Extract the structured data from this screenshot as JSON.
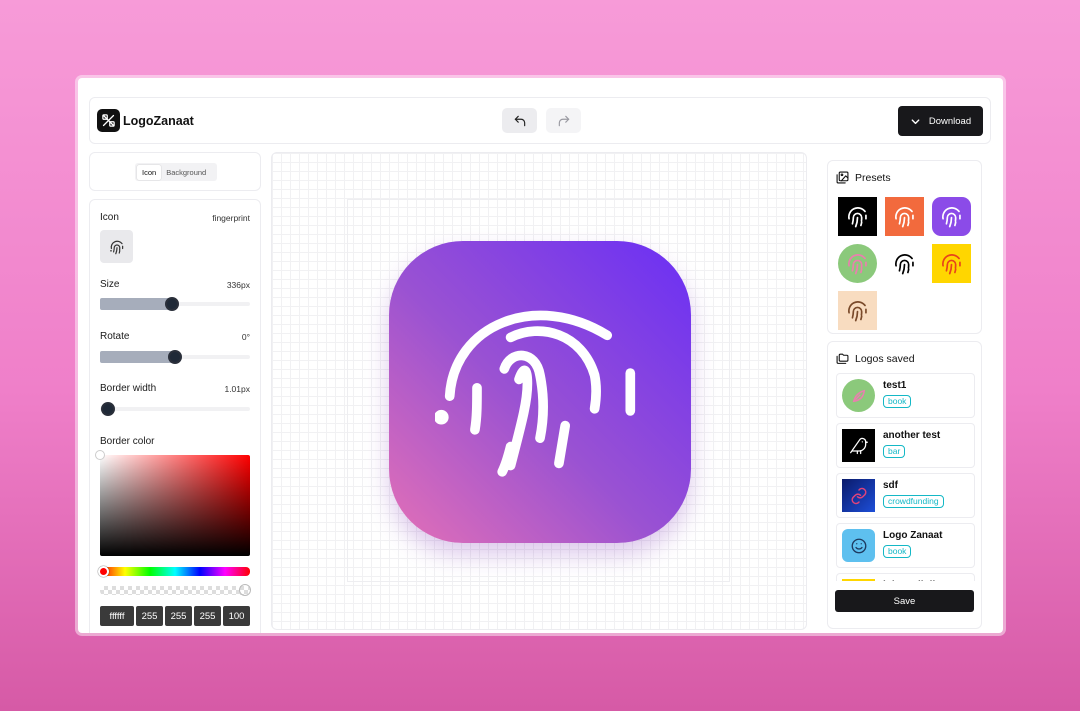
{
  "app": {
    "name": "LogoZanaat"
  },
  "header": {
    "download_label": "Download"
  },
  "tabs": [
    {
      "label": "Icon",
      "active": true
    },
    {
      "label": "Background",
      "active": false
    }
  ],
  "controls": {
    "icon": {
      "label": "Icon",
      "value": "fingerprint"
    },
    "size": {
      "label": "Size",
      "value": "336px",
      "level": 0.48
    },
    "rotate": {
      "label": "Rotate",
      "value": "0°",
      "level": 0.5
    },
    "border_width": {
      "label": "Border width",
      "value": "1.01px",
      "level": 0.05
    },
    "border_color": {
      "label": "Border color",
      "hex": "ffffff",
      "r": "255",
      "g": "255",
      "b": "255",
      "a": "100"
    }
  },
  "canvas": {
    "icon": "fingerprint-icon",
    "gradient": [
      "#6a2ff5",
      "#9a52d2",
      "#e470b6"
    ]
  },
  "presets": {
    "title": "Presets",
    "items": [
      {
        "bg": "#000000",
        "fg": "#ffffff",
        "shape": "square"
      },
      {
        "bg": "#f26a3d",
        "fg": "#ffffff",
        "shape": "square"
      },
      {
        "bg": "#8b4be8",
        "fg": "#ffffff",
        "shape": "rounded"
      },
      {
        "bg": "#8bc97b",
        "fg": "#ea7fae",
        "shape": "circle"
      },
      {
        "bg": "#ffffff",
        "fg": "#000000",
        "shape": "square"
      },
      {
        "bg": "#ffd600",
        "fg": "#e8431b",
        "shape": "square"
      },
      {
        "bg": "#f8dcc0",
        "fg": "#7a4a2a",
        "shape": "square"
      }
    ]
  },
  "saved": {
    "title": "Logos saved",
    "items": [
      {
        "name": "test1",
        "tag": "book",
        "icon": "leaf-icon"
      },
      {
        "name": "another test",
        "tag": "bar",
        "icon": "bird-icon"
      },
      {
        "name": "sdf",
        "tag": "crowdfunding",
        "icon": "link-icon"
      },
      {
        "name": "Logo Zanaat",
        "tag": "book",
        "icon": "smile-icon"
      },
      {
        "name": "lnksnvdlnlks",
        "tag": "",
        "icon": ""
      }
    ],
    "save_label": "Save"
  }
}
